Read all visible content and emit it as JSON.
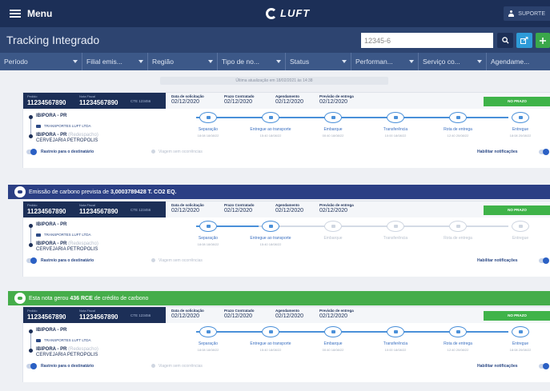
{
  "header": {
    "menu_label": "Menu",
    "logo_text": "LUFT",
    "user_label": "SUPORTE"
  },
  "title_bar": {
    "title": "Tracking Integrado",
    "search_value": "12345-6"
  },
  "filters": [
    "Período",
    "Filial emis...",
    "Região",
    "Tipo de no...",
    "Status",
    "Performan...",
    "Serviço co...",
    "Agendame..."
  ],
  "updated_text": "Última atualização em 18/02/2021 às 14:38",
  "cards": [
    {
      "pedido_label": "Pedido",
      "pedido": "11234567890",
      "nf_label": "Nota Fiscal",
      "nf": "11234567890",
      "cte": "CTE 123456",
      "dates": [
        {
          "label": "Data de solicitação",
          "value": "02/12/2020"
        },
        {
          "label": "Prazo Contratado",
          "value": "02/12/2020"
        },
        {
          "label": "Agendamento",
          "value": "02/12/2020"
        },
        {
          "label": "Previsão de entrega",
          "value": "02/12/2020"
        }
      ],
      "status": "NO PRAZO",
      "origin": "IBIPORA - PR",
      "carrier": "TRANSPORTES LUFT LTDA",
      "destination": "IBIPORA - PR",
      "destination_note": "(Redespacho)",
      "company": "CERVEJARIA PETROPOLIS",
      "progress": 1.0,
      "steps": [
        {
          "label": "Separação",
          "date": "18:08 18/08/22",
          "done": true
        },
        {
          "label": "Entregue ao transporte",
          "date": "15:40 18/08/22",
          "done": true
        },
        {
          "label": "Embarque",
          "date": "00:40 18/08/22",
          "done": true
        },
        {
          "label": "Transferência",
          "date": "10:00 18/08/22",
          "done": true
        },
        {
          "label": "Rota de entrega",
          "date": "12:40 20/08/22",
          "done": true
        },
        {
          "label": "Entregue",
          "date": "18:08 20/08/22",
          "done": true
        }
      ],
      "track_label": "Rastreio para o destinatário",
      "no_incident": "Viagem sem ocorrências",
      "notify_label": "Habilitar notificações"
    },
    {
      "pedido_label": "Pedido",
      "pedido": "11234567890",
      "nf_label": "Nota Fiscal",
      "nf": "11234567890",
      "cte": "CTE 123456",
      "dates": [
        {
          "label": "Data de solicitação",
          "value": "02/12/2020"
        },
        {
          "label": "Prazo Contratado",
          "value": "02/12/2020"
        },
        {
          "label": "Agendamento",
          "value": "02/12/2020"
        },
        {
          "label": "Previsão de entrega",
          "value": "02/12/2020"
        }
      ],
      "status": "NO PRAZO",
      "origin": "IBIPORA - PR",
      "carrier": "TRANSPORTES LUFT LTDA",
      "destination": "IBIPORA - PR",
      "destination_note": "(Redespacho)",
      "company": "CERVEJARIA PETROPOLIS",
      "progress": 0.2,
      "steps": [
        {
          "label": "Separação",
          "date": "18:08 18/08/22",
          "done": true
        },
        {
          "label": "Entregue ao transporte",
          "date": "15:40 18/08/22",
          "done": true
        },
        {
          "label": "Embarque",
          "date": "",
          "done": false
        },
        {
          "label": "Transferência",
          "date": "",
          "done": false
        },
        {
          "label": "Rota de entrega",
          "date": "",
          "done": false
        },
        {
          "label": "Entregue",
          "date": "",
          "done": false
        }
      ],
      "track_label": "Rastreio para o destinatário",
      "no_incident": "Viagem sem ocorrências",
      "notify_label": "Habilitar notificações"
    },
    {
      "pedido_label": "Pedido",
      "pedido": "11234567890",
      "nf_label": "Nota Fiscal",
      "nf": "11234567890",
      "cte": "CTE 123456",
      "dates": [
        {
          "label": "Data de solicitação",
          "value": "02/12/2020"
        },
        {
          "label": "Prazo Contratado",
          "value": "02/12/2020"
        },
        {
          "label": "Agendamento",
          "value": "02/12/2020"
        },
        {
          "label": "Previsão de entrega",
          "value": "02/12/2020"
        }
      ],
      "status": "NO PRAZO",
      "origin": "IBIPORA - PR",
      "carrier": "TRANSPORTES LUFT LTDA",
      "destination": "IBIPORA - PR",
      "destination_note": "(Redespacho)",
      "company": "CERVEJARIA PETROPOLIS",
      "progress": 1.0,
      "steps": [
        {
          "label": "Separação",
          "date": "18:08 18/08/22",
          "done": true
        },
        {
          "label": "Entregue ao transporte",
          "date": "15:40 18/08/22",
          "done": true
        },
        {
          "label": "Embarque",
          "date": "00:40 18/08/22",
          "done": true
        },
        {
          "label": "Transferência",
          "date": "10:00 18/08/22",
          "done": true
        },
        {
          "label": "Rota de entrega",
          "date": "12:40 20/08/22",
          "done": true
        },
        {
          "label": "Entregue",
          "date": "18:08 20/08/22",
          "done": true
        }
      ],
      "track_label": "Rastreio para o destinatário",
      "no_incident": "Viagem sem ocorrências",
      "notify_label": "Habilitar notificações"
    }
  ],
  "banners": {
    "carbon": {
      "prefix": "Emissão de carbono prevista de ",
      "value": "3,0003789428 T. CO2 EQ."
    },
    "credit": {
      "prefix": "Esta nota gerou ",
      "value": "436 RCE",
      "suffix": " de crédito de carbono"
    }
  },
  "colors": {
    "navy": "#1c2f57",
    "accent_blue": "#4a90d9",
    "status_green": "#3fb349",
    "banner_blue": "#2b3f84",
    "banner_green": "#45ad4a"
  }
}
